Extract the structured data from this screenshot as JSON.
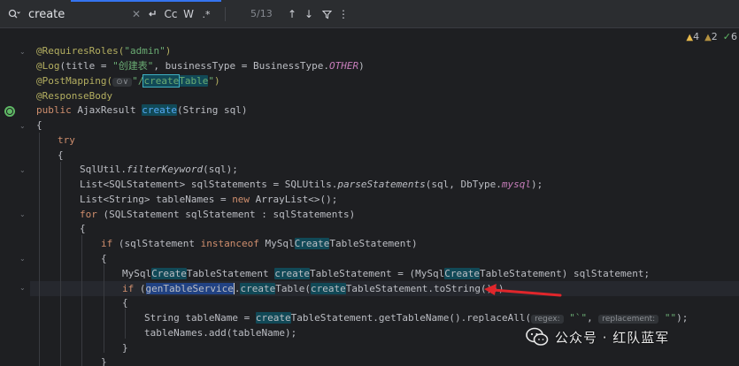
{
  "search": {
    "value": "create",
    "match_count": "5/13",
    "buttons": {
      "match_case": "Cc",
      "words": "W",
      "regex": ".*"
    }
  },
  "inspections": {
    "warnings": "4",
    "weak_warnings": "2",
    "ok": "6"
  },
  "code": {
    "l1_ann": "@RequiresRoles(",
    "l1_str": "\"admin\"",
    "l1_end": ")",
    "l2_ann": "@Log",
    "l2_a": "(title = ",
    "l2_str": "\"创建表\"",
    "l2_b": ", businessType = BusinessType.",
    "l2_const": "OTHER",
    "l2_end": ")",
    "l3_ann": "@PostMapping(",
    "l3_hint": "⊙∨",
    "l3_str1": "\"/",
    "l3_m1": "create",
    "l3_m2": "Table",
    "l3_str2": "\"",
    "l3_end": ")",
    "l4_ann": "@ResponseBody",
    "l5_kw": "public",
    "l5_a": " AjaxResult ",
    "l5_m": "create",
    "l5_b": "(String sql)",
    "l6": "{",
    "l7_kw": "try",
    "l8": "{",
    "l9_a": "SqlUtil.",
    "l9_fn": "filterKeyword",
    "l9_b": "(sql);",
    "l10_a": "List<SQLStatement> sqlStatements = SQLUtils.",
    "l10_fn": "parseStatements",
    "l10_b": "(sql, DbType.",
    "l10_const": "mysql",
    "l10_c": ");",
    "l11_a": "List<String> tableNames = ",
    "l11_kw": "new",
    "l11_b": " ArrayList<>();",
    "l12_kw": "for",
    "l12_a": " (SQLStatement sqlStatement : sqlStatements)",
    "l13": "{",
    "l14_kw": "if",
    "l14_a": " (sqlStatement ",
    "l14_kw2": "instanceof",
    "l14_b": " MySql",
    "l14_m": "Create",
    "l14_c": "TableStatement)",
    "l15": "{",
    "l16_a": "MySql",
    "l16_m1": "Create",
    "l16_b": "TableStatement ",
    "l16_m2": "create",
    "l16_c": "TableStatement = (MySql",
    "l16_m3": "Create",
    "l16_d": "TableStatement) sqlStatement;",
    "l17_kw": "if",
    "l17_a": " (",
    "l17_sel": "genTableService",
    "l17_b": ".",
    "l17_m1": "create",
    "l17_c": "Table(",
    "l17_m2": "create",
    "l17_d": "TableStatement.toString()))",
    "l18": "{",
    "l19_a": "String tableName = ",
    "l19_m": "create",
    "l19_b": "TableStatement.getTableName().replaceAll(",
    "l19_h1": "regex:",
    "l19_s1": "\"`\"",
    "l19_c": ",",
    "l19_h2": "replacement:",
    "l19_s2": "\"\"",
    "l19_d": ");",
    "l20": "tableNames.add(tableName);",
    "l21": "}",
    "l22": "}"
  },
  "watermark": {
    "text": "公众号 · 红队蓝军"
  },
  "colors": {
    "background": "#1e1f22",
    "keyword": "#cf8e6d",
    "annotation": "#b3ae60",
    "string": "#6aab73",
    "method": "#56a8f5",
    "match_highlight": "#114957",
    "selection": "#214283",
    "arrow": "#e0262b"
  }
}
